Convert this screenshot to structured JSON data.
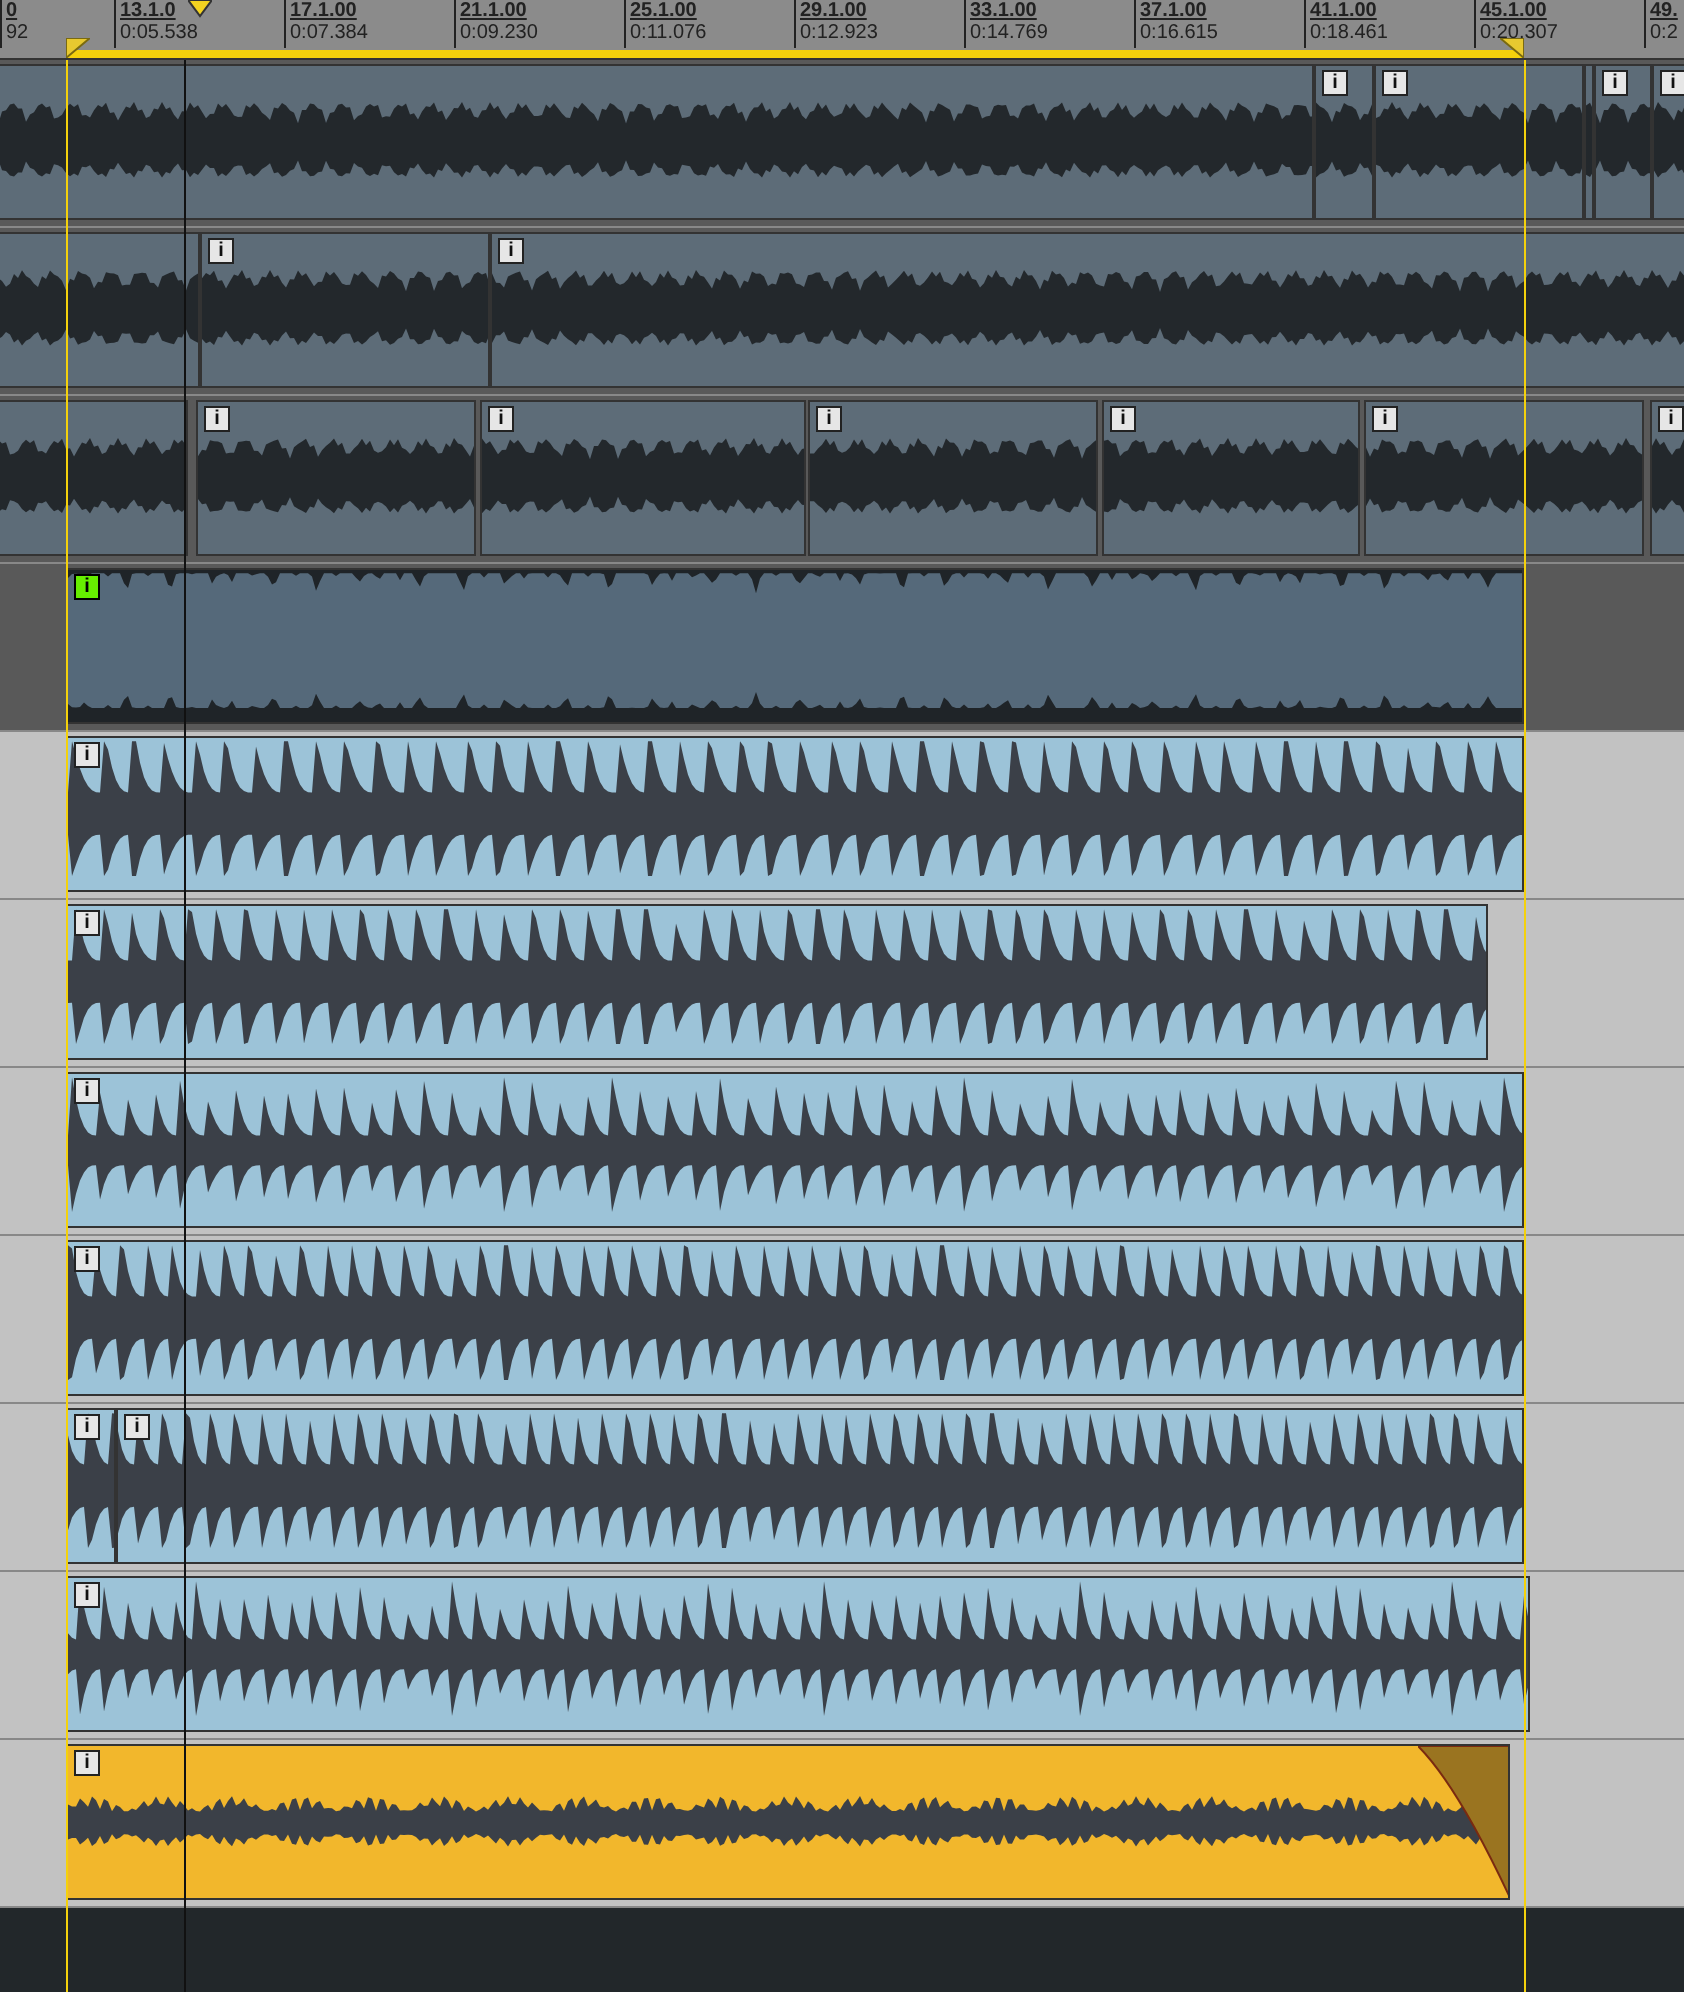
{
  "ruler": {
    "markers": [
      {
        "bar": "0",
        "time": "92"
      },
      {
        "bar": "13.1.0",
        "time": "0:05.538"
      },
      {
        "bar": "17.1.00",
        "time": "0:07.384"
      },
      {
        "bar": "21.1.00",
        "time": "0:09.230"
      },
      {
        "bar": "25.1.00",
        "time": "0:11.076"
      },
      {
        "bar": "29.1.00",
        "time": "0:12.923"
      },
      {
        "bar": "33.1.00",
        "time": "0:14.769"
      },
      {
        "bar": "37.1.00",
        "time": "0:16.615"
      },
      {
        "bar": "41.1.00",
        "time": "0:18.461"
      },
      {
        "bar": "45.1.00",
        "time": "0:20.307"
      },
      {
        "bar": "49.",
        "time": "0:2"
      }
    ]
  },
  "tracks": [
    {
      "clips": [
        {
          "color": "#5d6c78",
          "fade": false
        },
        {
          "info": "i",
          "color": "#5d6c78",
          "highlighted": false,
          "fade": false
        },
        {
          "info": "i",
          "color": "#5d6c78",
          "highlighted": false,
          "fade": false
        },
        {
          "color": "#5d6c78",
          "fade": false
        },
        {
          "info": "i",
          "color": "#5d6c78",
          "highlighted": false,
          "fade": false
        },
        {
          "info": "i",
          "color": "#5d6c78",
          "highlighted": false,
          "fade": false
        }
      ]
    },
    {
      "clips": [
        {
          "color": "#5d6c78",
          "fade": false
        },
        {
          "info": "i",
          "color": "#5d6c78",
          "highlighted": false,
          "fade": false
        },
        {
          "info": "i",
          "color": "#5d6c78",
          "highlighted": false,
          "fade": false
        }
      ]
    },
    {
      "clips": [
        {
          "color": "#5d6c78",
          "fade": false
        },
        {
          "info": "i",
          "color": "#5d6c78",
          "highlighted": false,
          "fade": false
        },
        {
          "info": "i",
          "color": "#5d6c78",
          "highlighted": false,
          "fade": false
        },
        {
          "info": "i",
          "color": "#5d6c78",
          "highlighted": false,
          "fade": false
        },
        {
          "info": "i",
          "color": "#5d6c78",
          "highlighted": false,
          "fade": false
        },
        {
          "info": "i",
          "color": "#5d6c78",
          "highlighted": false,
          "fade": false
        },
        {
          "info": "i",
          "color": "#5d6c78",
          "highlighted": false,
          "fade": false
        }
      ]
    },
    {
      "clips": [
        {
          "info": "i",
          "color": "#1f2428",
          "highlighted": true,
          "fade": false
        }
      ]
    },
    {
      "clips": [
        {
          "info": "i",
          "color": "#9cc3d8",
          "highlighted": false,
          "fade": false
        }
      ]
    },
    {
      "clips": [
        {
          "info": "i",
          "color": "#9cc3d8",
          "highlighted": false,
          "fade": false
        }
      ]
    },
    {
      "clips": [
        {
          "info": "i",
          "color": "#9cc3d8",
          "highlighted": false,
          "fade": false
        }
      ]
    },
    {
      "clips": [
        {
          "info": "i",
          "color": "#9cc3d8",
          "highlighted": false,
          "fade": false
        }
      ]
    },
    {
      "clips": [
        {
          "info": "i",
          "color": "#9cc3d8",
          "highlighted": false,
          "fade": false
        },
        {
          "info": "i",
          "color": "#9cc3d8",
          "highlighted": false,
          "fade": false
        }
      ]
    },
    {
      "clips": [
        {
          "info": "i",
          "color": "#9cc3d8",
          "highlighted": false,
          "fade": false
        }
      ]
    },
    {
      "clips": [
        {
          "info": "i",
          "color": "#f2b72c",
          "highlighted": false,
          "fade": true
        }
      ]
    }
  ]
}
